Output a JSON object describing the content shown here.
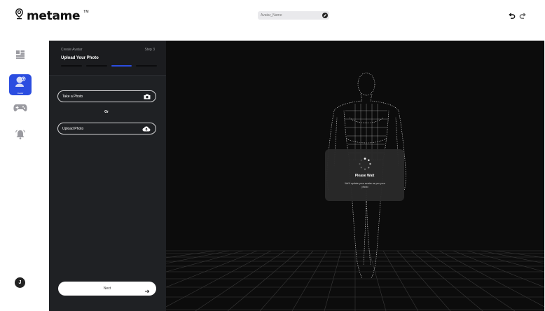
{
  "app": {
    "logo_text": "metame",
    "logo_tm": "TM"
  },
  "header": {
    "name_placeholder": "Avatar_Name",
    "icons": {
      "edit": "pencil-icon",
      "undo": "undo-icon",
      "redo": "redo-icon"
    }
  },
  "rail": {
    "items": [
      {
        "name": "dashboard",
        "icon": "dashboard-icon",
        "label": "",
        "active": false
      },
      {
        "name": "avatar",
        "icon": "avatar-icon",
        "label": "Avatar",
        "active": true
      },
      {
        "name": "games",
        "icon": "gamepad-icon",
        "label": "",
        "active": false
      },
      {
        "name": "notifications",
        "icon": "bell-icon",
        "label": "",
        "active": false
      }
    ],
    "user_initial": "J",
    "accent": "#2b4de0"
  },
  "panel": {
    "breadcrumb": "Create Avatar",
    "step": "Step 3",
    "title": "Upload Your Photo",
    "progress": {
      "total": 4,
      "current": 3
    },
    "options": [
      {
        "label": "Take a Photo",
        "icon": "camera-icon"
      },
      {
        "label": "Upload Photo",
        "icon": "cloud-upload-icon"
      }
    ],
    "or_text": "Or",
    "next_label": "Next"
  },
  "viewport": {
    "wait_title": "Please Wait",
    "wait_message": "We'll update your avatar as per your photo"
  }
}
